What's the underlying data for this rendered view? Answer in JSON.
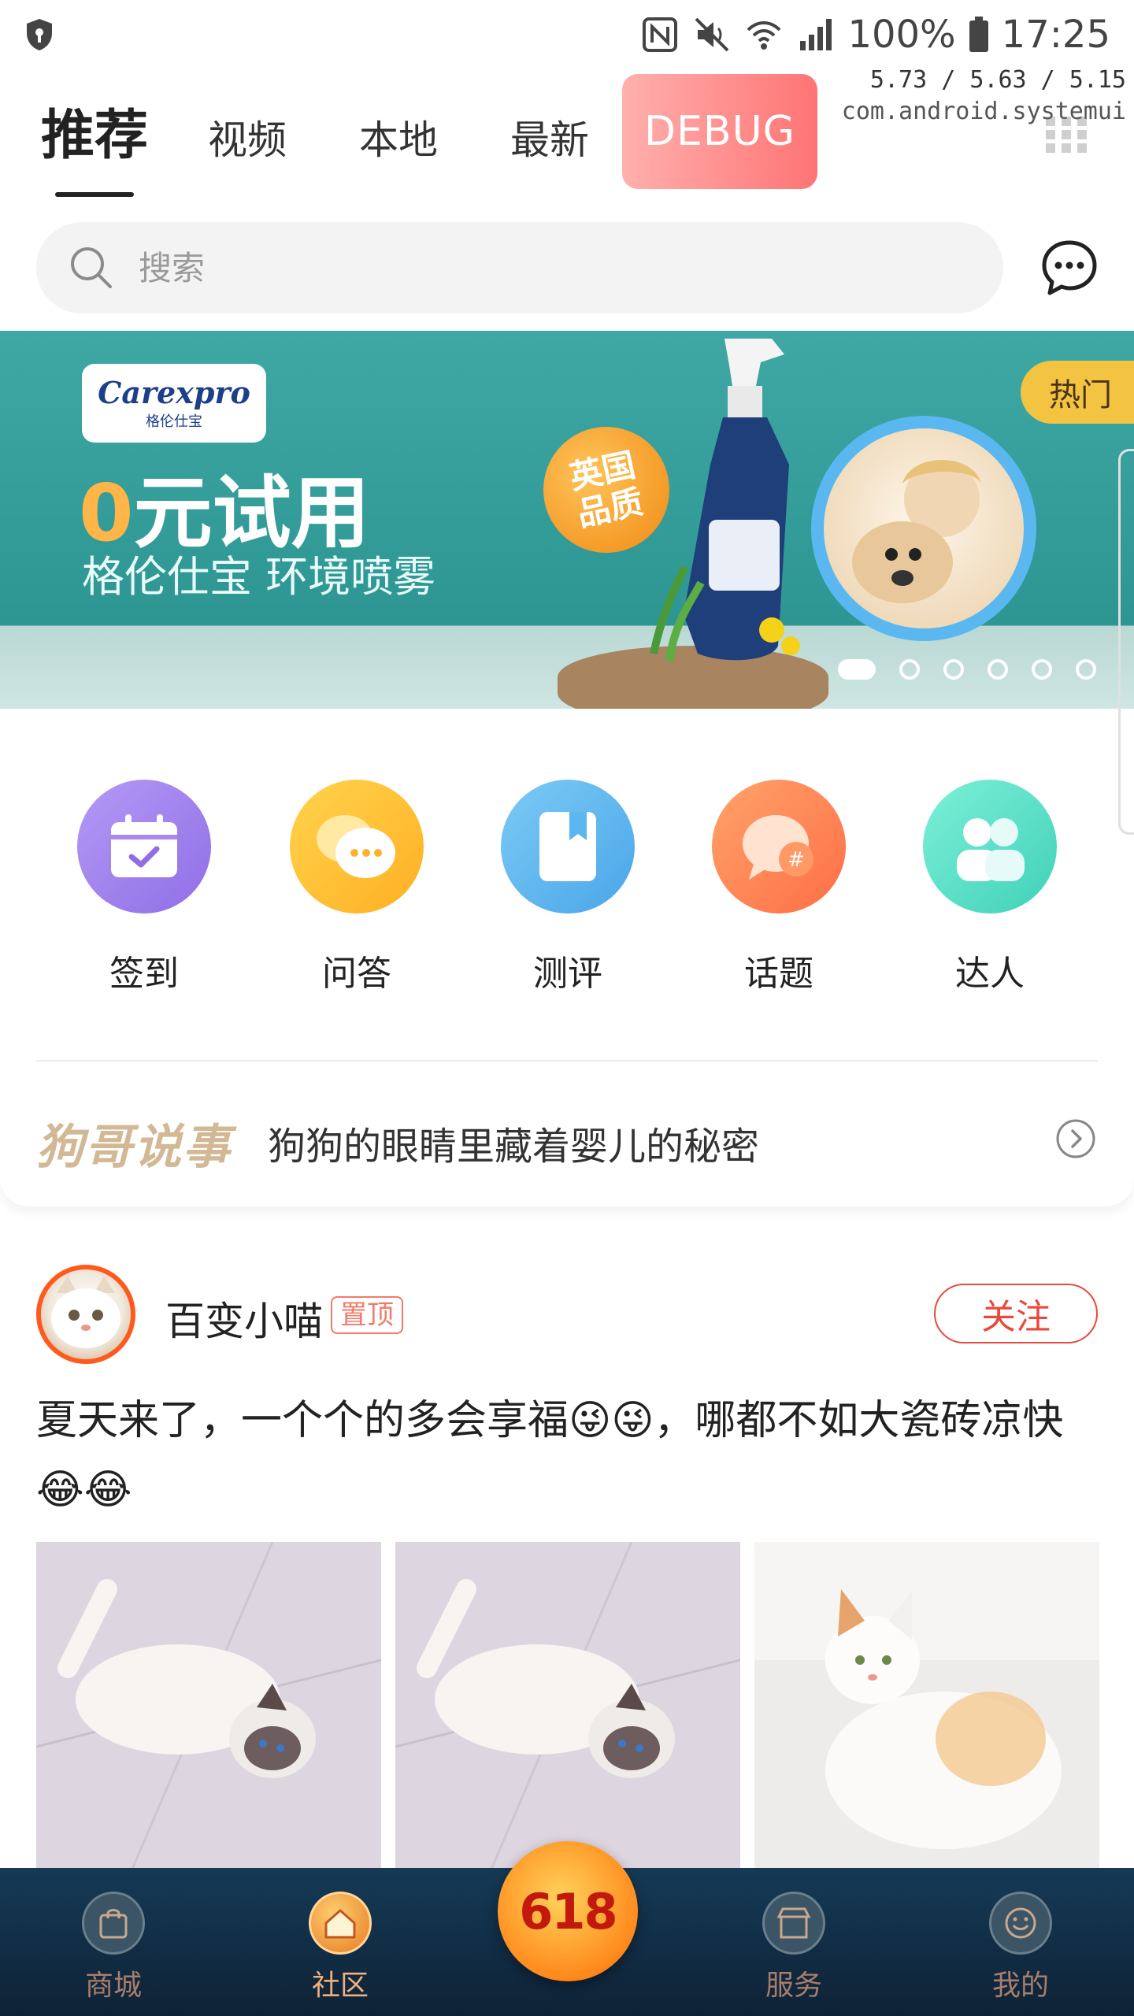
{
  "status_bar": {
    "battery": "100%",
    "time": "17:25"
  },
  "debug_overlay": {
    "line1": "5.73 / 5.63 / 5.15",
    "line2": "com.android.systemui"
  },
  "tabs": [
    {
      "label": "推荐",
      "active": true
    },
    {
      "label": "视频"
    },
    {
      "label": "本地"
    },
    {
      "label": "最新"
    }
  ],
  "debug_button": "DEBUG",
  "search": {
    "placeholder": "搜索"
  },
  "banner": {
    "logo_text": "Carexpro",
    "logo_sub": "格伦仕宝",
    "title_zero": "0",
    "title_rest": "元试用",
    "subtitle": "格伦仕宝 环境喷雾",
    "badge_line1": "英国",
    "badge_line2": "品质",
    "hot_label": "热门",
    "slide_count": 6,
    "active_slide": 1
  },
  "quick_entries": [
    {
      "label": "签到",
      "icon": "calendar-check-icon",
      "color": "#a186ee"
    },
    {
      "label": "问答",
      "icon": "chat-bubbles-icon",
      "color": "#ffc23c"
    },
    {
      "label": "测评",
      "icon": "bookmark-book-icon",
      "color": "#5cb6ef"
    },
    {
      "label": "话题",
      "icon": "topic-hash-icon",
      "color": "#ff8a5a"
    },
    {
      "label": "达人",
      "icon": "people-icon",
      "color": "#5fdcc6"
    }
  ],
  "story": {
    "brand": "狗哥说事",
    "headline": "狗狗的眼睛里藏着婴儿的秘密"
  },
  "post": {
    "author": "百变小喵",
    "pin_label": "置顶",
    "follow_label": "关注",
    "content": "夏天来了，一个个的多会享福😜😜，哪都不如大瓷砖凉快😂😂"
  },
  "bottom_nav": [
    {
      "label": "商城",
      "icon": "shopping-bag-icon"
    },
    {
      "label": "社区",
      "icon": "home-icon",
      "active": true
    },
    {
      "label": "服务",
      "icon": "store-icon"
    },
    {
      "label": "我的",
      "icon": "face-icon"
    }
  ],
  "promo": {
    "label": "618"
  },
  "colors": {
    "accent_red": "#e8493a",
    "nav_bg": "#153a56",
    "debug_btn": "#ff7474"
  }
}
